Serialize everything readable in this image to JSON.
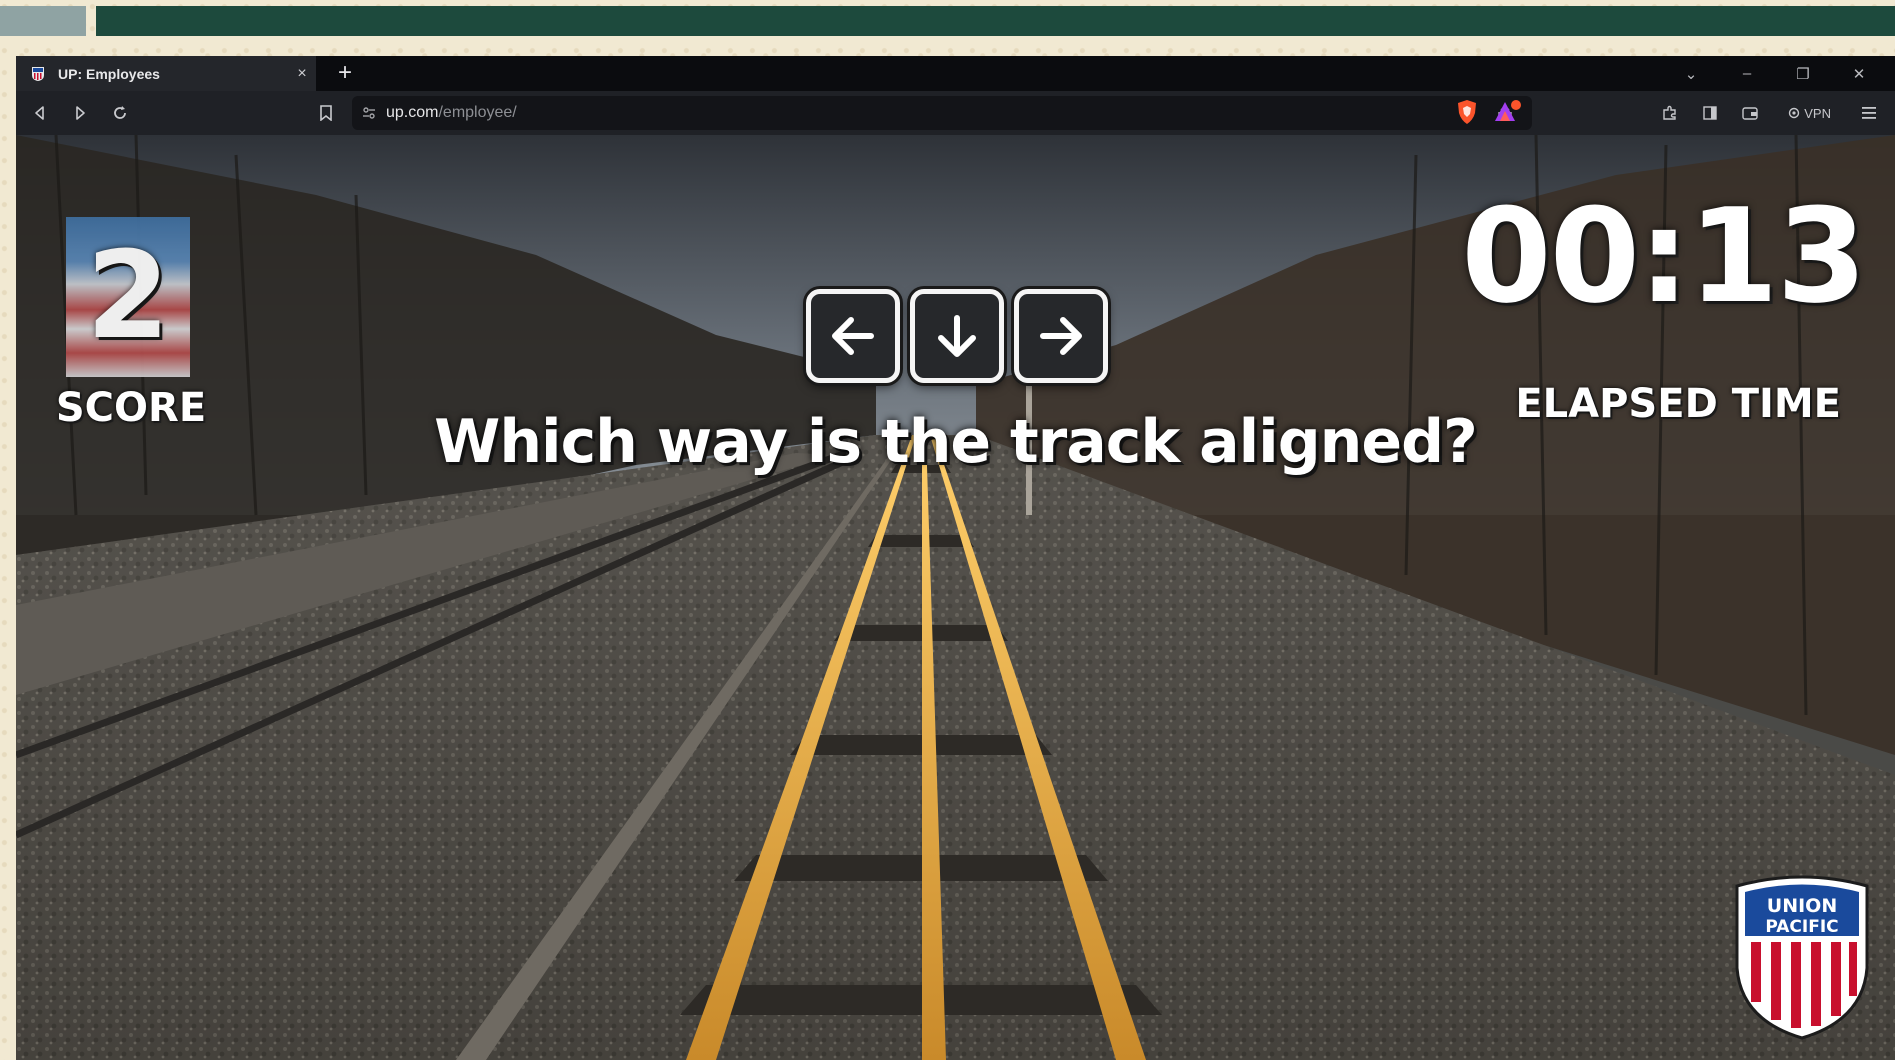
{
  "browser": {
    "tab_title": "UP: Employees",
    "tab_close": "×",
    "new_tab": "+",
    "url_domain": "up.com",
    "url_path": "/employee/",
    "vpn_label": "VPN",
    "window_controls": [
      "⌄",
      "–",
      "❐",
      "✕"
    ]
  },
  "game": {
    "score_value": "2",
    "score_label": "SCORE",
    "time_value": "00:13",
    "time_label": "ELAPSED TIME",
    "question": "Which way is the track aligned?",
    "arrow_keys": [
      "left-arrow",
      "down-arrow",
      "right-arrow"
    ]
  },
  "logo": {
    "line1": "UNION",
    "line2": "PACIFIC"
  },
  "colors": {
    "frame_green": "#1d4a3d",
    "frame_gray": "#8fa3a3",
    "up_blue": "#1a4a9c",
    "up_red": "#c8102e"
  }
}
